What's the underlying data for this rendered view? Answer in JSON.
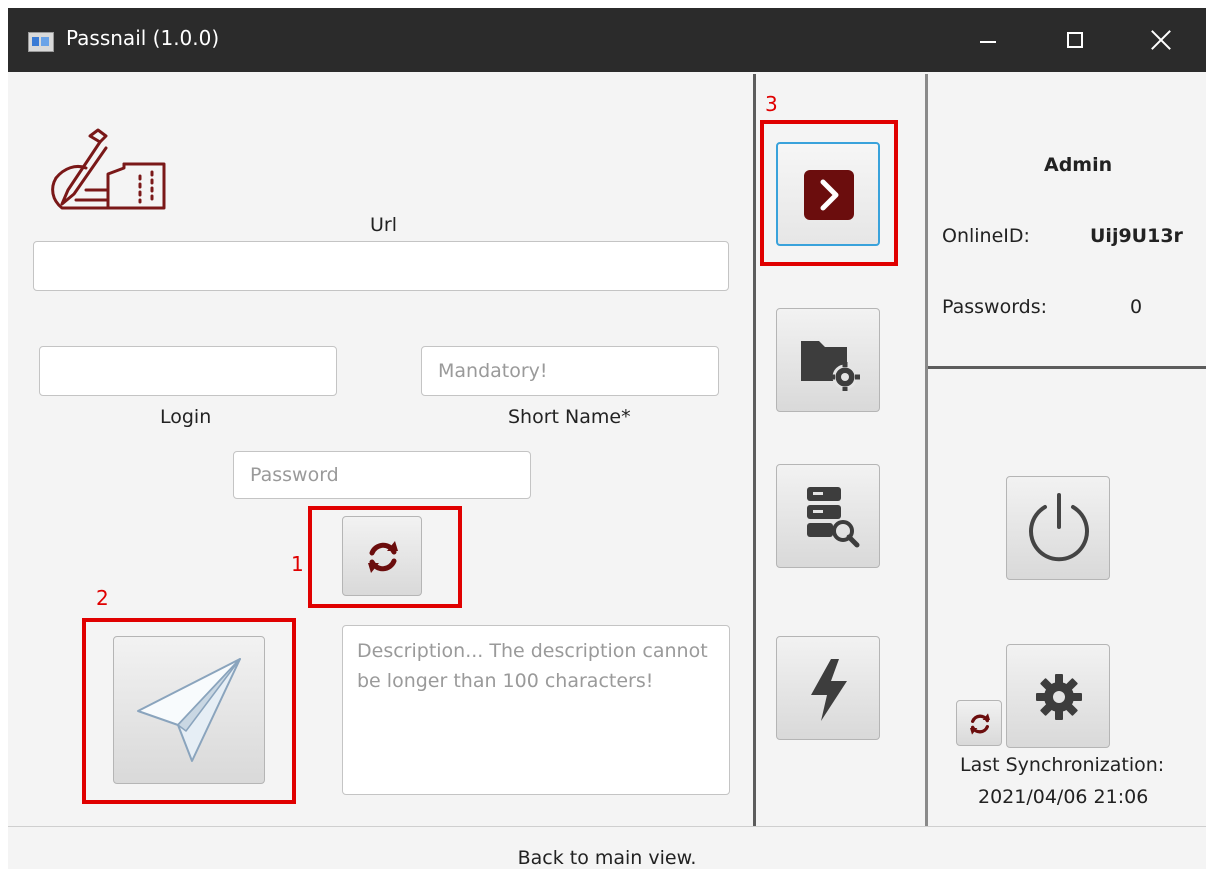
{
  "window": {
    "title": "Passnail (1.0.0)"
  },
  "form": {
    "url_label": "Url",
    "url_value": "",
    "login_label": "Login",
    "login_value": "",
    "short_name_label": "Short Name*",
    "short_name_placeholder": "Mandatory!",
    "password_placeholder": "Password",
    "description_placeholder": "Description... The description cannot be longer than 100 characters!"
  },
  "annotations": {
    "marker_1": "1",
    "marker_2": "2",
    "marker_3": "3",
    "color": "#e00000"
  },
  "toolbar": {
    "items": [
      {
        "name": "back-button",
        "icon": "chevron-right-icon"
      },
      {
        "name": "folder-settings-button",
        "icon": "folder-gear-icon"
      },
      {
        "name": "database-search-button",
        "icon": "database-search-icon"
      },
      {
        "name": "lightning-button",
        "icon": "lightning-icon"
      }
    ]
  },
  "account": {
    "username": "Admin",
    "online_id_label": "OnlineID:",
    "online_id_value": "Uij9U13r",
    "passwords_label": "Passwords:",
    "passwords_value": "0"
  },
  "sync": {
    "last_sync_label": "Last Synchronization:",
    "last_sync_value": "2021/04/06 21:06"
  },
  "status": {
    "text": "Back to main view."
  },
  "colors": {
    "accent_dark_red": "#6b0d0d",
    "focus_blue": "#39a2db",
    "titlebar": "#2b2b2b"
  }
}
